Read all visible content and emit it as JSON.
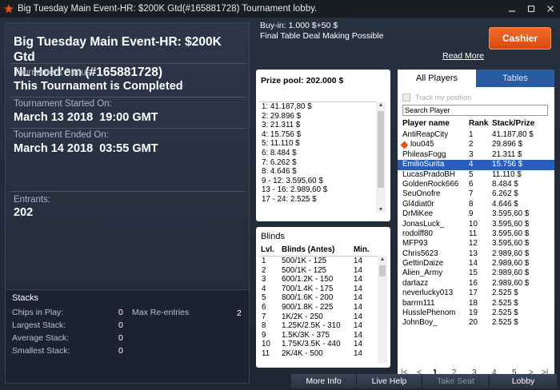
{
  "window": {
    "title": "Big Tuesday Main Event-HR: $200K Gtd(#165881728) Tournament lobby."
  },
  "tourney": {
    "title_line1": "Big Tuesday Main Event-HR: $200K Gtd",
    "title_line2": "NL Hold'em (#165881728)",
    "status_label": "Tournament Status:",
    "status_value": "This Tournament is Completed",
    "started_label": "Tournament Started On:",
    "started_value": "March 13 2018  19:00 GMT",
    "ended_label": "Tournament Ended On:",
    "ended_value": "March 14 2018  03:55 GMT",
    "entrants_label": "Entrants:",
    "entrants_value": "202"
  },
  "stacks": {
    "title": "Stacks",
    "chips_label": "Chips in Play:",
    "chips_value": "0",
    "largest_label": "Largest Stack:",
    "largest_value": "0",
    "average_label": "Average Stack:",
    "average_value": "0",
    "smallest_label": "Smallest Stack:",
    "smallest_value": "0",
    "reentries_label": "Max Re-entries",
    "reentries_value": "2"
  },
  "buyin": {
    "line1": "Buy-in: 1.000 $+50 $",
    "line2": "Final Table Deal Making Possible",
    "read_more": "Read More"
  },
  "cashier_label": "Cashier",
  "prize_pool": {
    "header": "Prize pool: 202.000 $",
    "rows": [
      "1: 41.187,80 $",
      "2: 29.896 $",
      "3: 21.311 $",
      "4: 15.756 $",
      "5: 11.110 $",
      "6: 8.484 $",
      "7: 6.262 $",
      "8: 4.646 $",
      "9 - 12: 3.595,60 $",
      "13 - 16: 2.989,60 $",
      "17 - 24: 2.525 $"
    ]
  },
  "blinds": {
    "title": "Blinds",
    "hdr_lvl": "Lvl.",
    "hdr_blinds": "Blinds (Antes)",
    "hdr_min": "Min.",
    "rows": [
      [
        "1",
        "500/1K - 125",
        "14"
      ],
      [
        "2",
        "500/1K - 125",
        "14"
      ],
      [
        "3",
        "600/1.2K - 150",
        "14"
      ],
      [
        "4",
        "700/1.4K - 175",
        "14"
      ],
      [
        "5",
        "800/1.6K - 200",
        "14"
      ],
      [
        "6",
        "900/1.8K - 225",
        "14"
      ],
      [
        "7",
        "1K/2K - 250",
        "14"
      ],
      [
        "8",
        "1.25K/2.5K - 310",
        "14"
      ],
      [
        "9",
        "1.5K/3K - 375",
        "14"
      ],
      [
        "10",
        "1.75K/3.5K - 440",
        "14"
      ],
      [
        "11",
        "2K/4K - 500",
        "14"
      ]
    ]
  },
  "players": {
    "tab_all": "All Players",
    "tab_tables": "Tables",
    "track_label": "Track my position",
    "search_placeholder": "Search Player",
    "hdr_name": "Player name",
    "hdr_rank": "Rank",
    "hdr_stack": "Stack/Prize",
    "selected_index": 4,
    "rows": [
      [
        "AntiReapCity",
        "1",
        "41.187,80 $"
      ],
      [
        "lou045",
        "2",
        "29.896 $"
      ],
      [
        "PhileasFogg",
        "3",
        "21.311 $"
      ],
      [
        "EmilioSurita",
        "4",
        "15.756 $"
      ],
      [
        "LucasPradoBH",
        "5",
        "11.110 $"
      ],
      [
        "GoldenRock666",
        "6",
        "8.484 $"
      ],
      [
        "SeuOnofre",
        "7",
        "6.262 $"
      ],
      [
        "Gl4diat0r",
        "8",
        "4.646 $"
      ],
      [
        "DrMiKee",
        "9",
        "3.595,60 $"
      ],
      [
        "JonasLuck_",
        "10",
        "3.595,60 $"
      ],
      [
        "rodolff80",
        "11",
        "3.595,60 $"
      ],
      [
        "MFP93",
        "12",
        "3.595,60 $"
      ],
      [
        "Chris5623",
        "13",
        "2.989,60 $"
      ],
      [
        "GettinDaize",
        "14",
        "2.989,60 $"
      ],
      [
        "Alien_Army",
        "15",
        "2.989,60 $"
      ],
      [
        "dartazz",
        "16",
        "2.989,60 $"
      ],
      [
        "neverlucky013",
        "17",
        "2.525 $"
      ],
      [
        "barrm111",
        "18",
        "2.525 $"
      ],
      [
        "HusslePhenom",
        "19",
        "2.525 $"
      ],
      [
        "JohnBoy_",
        "20",
        "2.525 $"
      ]
    ],
    "pages": [
      "1",
      "2",
      "3",
      "4",
      "5"
    ]
  },
  "buttons": {
    "more_info": "More Info",
    "live_help": "Live Help",
    "take_seat": "Take Seat",
    "lobby": "Lobby"
  },
  "colors": {
    "accent": "#e8501c",
    "selected_row": "#2a5ebd",
    "tab_inactive": "#2a5aa0"
  }
}
